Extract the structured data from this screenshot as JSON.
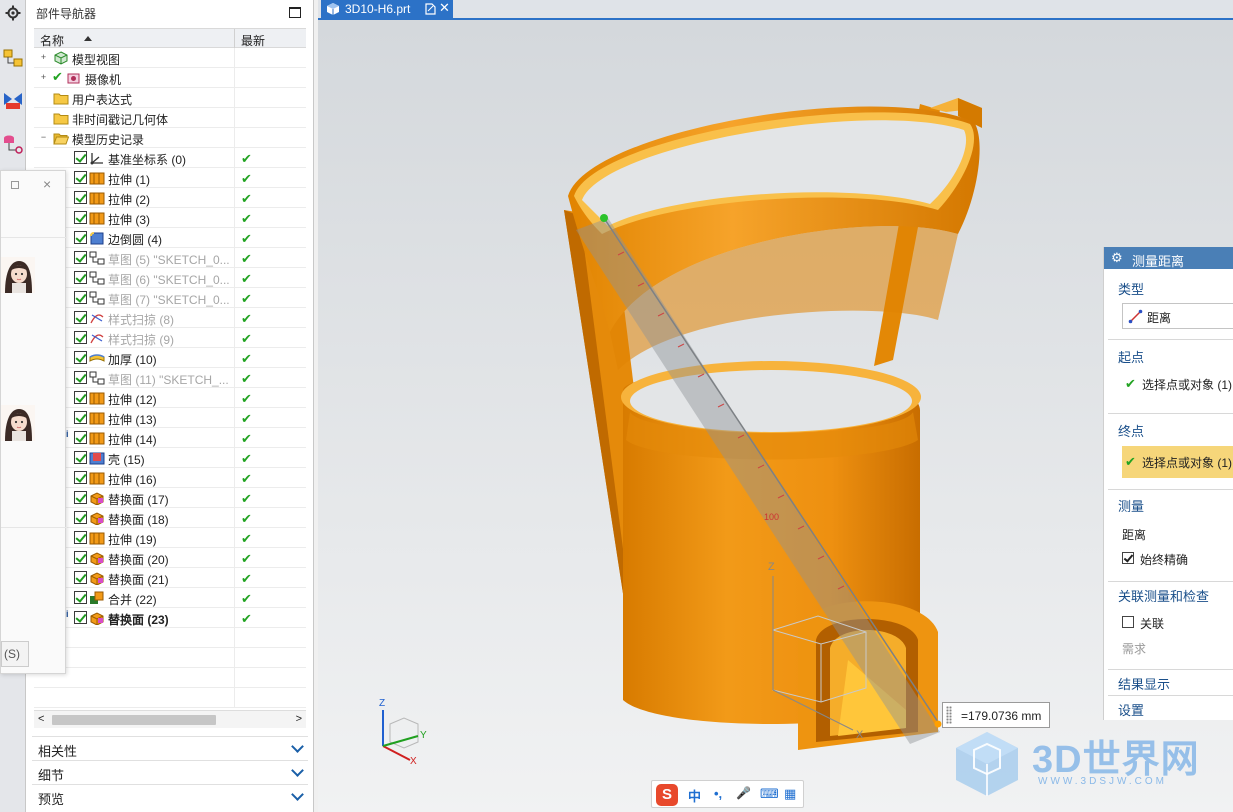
{
  "navigator": {
    "title": "部件导航器",
    "columns": {
      "name": "名称",
      "latest": "最新"
    },
    "rows": [
      {
        "label": "模型视图",
        "level": 0,
        "expander": "+",
        "checkbox": false,
        "icon": "model-view-icon",
        "latest": ""
      },
      {
        "label": "摄像机",
        "level": 0,
        "expander": "+",
        "checkbox": false,
        "icon": "camera-icon",
        "latest": ""
      },
      {
        "label": "用户表达式",
        "level": 0,
        "expander": "",
        "checkbox": false,
        "icon": "folder-icon",
        "latest": ""
      },
      {
        "label": "非时间戳记几何体",
        "level": 0,
        "expander": "",
        "checkbox": false,
        "icon": "folder-icon",
        "latest": ""
      },
      {
        "label": "模型历史记录",
        "level": 0,
        "expander": "−",
        "checkbox": false,
        "icon": "folder-open-icon",
        "latest": ""
      },
      {
        "label": "基准坐标系 (0)",
        "level": 1,
        "icon": "datum-csys-icon",
        "latest": "✔"
      },
      {
        "label": "拉伸 (1)",
        "level": 1,
        "icon": "extrude-icon",
        "latest": "✔"
      },
      {
        "label": "拉伸 (2)",
        "level": 1,
        "icon": "extrude-icon",
        "latest": "✔"
      },
      {
        "label": "拉伸 (3)",
        "level": 1,
        "icon": "extrude-icon",
        "latest": "✔"
      },
      {
        "label": "边倒圆 (4)",
        "level": 1,
        "icon": "edge-blend-icon",
        "latest": "✔"
      },
      {
        "label": "草图 (5) \"SKETCH_0...",
        "level": 1,
        "icon": "sketch-icon",
        "dim": true,
        "latest": "✔"
      },
      {
        "label": "草图 (6) \"SKETCH_0...",
        "level": 1,
        "icon": "sketch-icon",
        "dim": true,
        "latest": "✔"
      },
      {
        "label": "草图 (7) \"SKETCH_0...",
        "level": 1,
        "icon": "sketch-icon",
        "dim": true,
        "latest": "✔"
      },
      {
        "label": "样式扫掠 (8)",
        "level": 1,
        "icon": "styled-sweep-icon",
        "dim": true,
        "latest": "✔"
      },
      {
        "label": "样式扫掠 (9)",
        "level": 1,
        "icon": "styled-sweep-icon",
        "dim": true,
        "latest": "✔"
      },
      {
        "label": "加厚 (10)",
        "level": 1,
        "icon": "thicken-icon",
        "latest": "✔"
      },
      {
        "label": "草图 (11) \"SKETCH_...",
        "level": 1,
        "icon": "sketch-icon",
        "dim": true,
        "latest": "✔"
      },
      {
        "label": "拉伸 (12)",
        "level": 1,
        "icon": "extrude-icon",
        "latest": "✔"
      },
      {
        "label": "拉伸 (13)",
        "level": 1,
        "icon": "extrude-icon",
        "latest": "✔"
      },
      {
        "label": "拉伸 (14)",
        "level": 1,
        "icon": "extrude-icon",
        "info": true,
        "latest": "✔"
      },
      {
        "label": "壳 (15)",
        "level": 1,
        "icon": "shell-icon",
        "latest": "✔"
      },
      {
        "label": "拉伸 (16)",
        "level": 1,
        "icon": "extrude-icon",
        "latest": "✔"
      },
      {
        "label": "替换面 (17)",
        "level": 1,
        "icon": "replace-face-icon",
        "latest": "✔"
      },
      {
        "label": "替换面 (18)",
        "level": 1,
        "icon": "replace-face-icon",
        "latest": "✔"
      },
      {
        "label": "拉伸 (19)",
        "level": 1,
        "icon": "extrude-icon",
        "latest": "✔"
      },
      {
        "label": "替换面 (20)",
        "level": 1,
        "icon": "replace-face-icon",
        "latest": "✔"
      },
      {
        "label": "替换面 (21)",
        "level": 1,
        "icon": "replace-face-icon",
        "latest": "✔"
      },
      {
        "label": "合并 (22)",
        "level": 1,
        "icon": "unite-icon",
        "latest": "✔"
      },
      {
        "label": "替换面 (23)",
        "level": 1,
        "icon": "replace-face-icon",
        "info": true,
        "bold": true,
        "latest": "✔"
      }
    ],
    "panels": [
      "相关性",
      "细节",
      "预览"
    ]
  },
  "popup": {
    "bottom_label": "(S)"
  },
  "tab": {
    "title": "3D10-H6.prt",
    "close": "✕"
  },
  "viewport": {
    "ruler_label": "100",
    "triad": {
      "x": "X",
      "y": "Y",
      "z": "Z"
    }
  },
  "measurement": {
    "readout": "=179.0736 mm"
  },
  "dialog": {
    "title": "测量距离",
    "type_section": "类型",
    "type_value": "距离",
    "start_section": "起点",
    "start_pick": "选择点或对象 (1)",
    "end_section": "终点",
    "end_pick": "选择点或对象 (1)",
    "measure_section": "测量",
    "measure_value": "距离",
    "always_precise": "始终精确",
    "assoc_section": "关联测量和检查",
    "associative": "关联",
    "requirement": "需求",
    "result_display": "结果显示",
    "settings": "设置"
  },
  "ime": {
    "logo": "S",
    "mode": "中",
    "punct": "•,",
    "mic": "🎤",
    "keyboard": "⌨",
    "grid": "▦"
  },
  "watermark": {
    "text": "3D世界网",
    "sub": "WWW.3DSJW.COM"
  },
  "colors": {
    "part": "#f0920c",
    "part_dark": "#c46f00",
    "rim": "#ffd24a",
    "accent": "#2c72c7",
    "dialog_header": "#4a7fb6",
    "highlight": "#f6d67a"
  }
}
